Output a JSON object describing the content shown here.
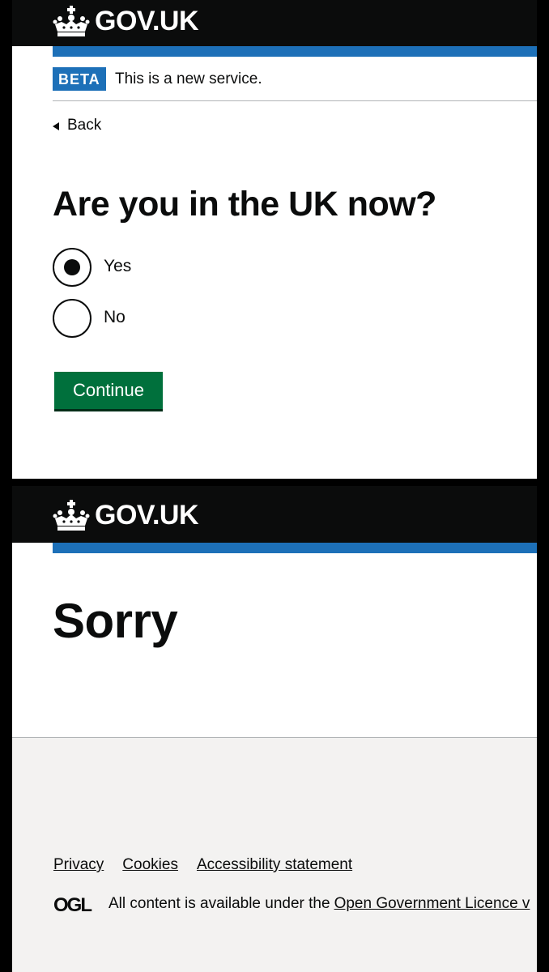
{
  "header": {
    "logotype": "GOV.UK",
    "crown_icon": "crown-icon"
  },
  "phase_banner": {
    "tag": "BETA",
    "text": "This is a new service."
  },
  "back_link": {
    "label": "Back",
    "icon": "triangle-left-icon"
  },
  "question": {
    "heading": "Are you in the UK now?",
    "options": [
      {
        "label": "Yes",
        "selected": true
      },
      {
        "label": "No",
        "selected": false
      }
    ],
    "submit_label": "Continue"
  },
  "error_page": {
    "heading": "Sorry"
  },
  "footer": {
    "links": [
      {
        "label": "Privacy"
      },
      {
        "label": "Cookies"
      },
      {
        "label": "Accessibility statement"
      }
    ],
    "licence_logo": "OGL",
    "licence_prefix": "All content is available under the",
    "licence_link": "Open Government Licence v"
  },
  "colors": {
    "header_bg": "#0b0c0c",
    "brand_blue": "#1d70b8",
    "button_green": "#00703c",
    "footer_bg": "#f3f2f1"
  }
}
